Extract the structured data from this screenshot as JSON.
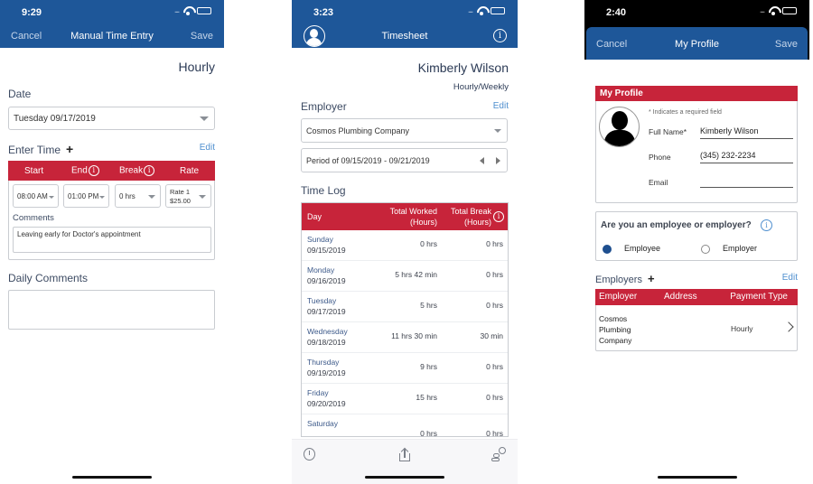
{
  "colors": {
    "nav_blue": "#1e5799",
    "header_red": "#c7243a",
    "link_blue": "#4f8fcf"
  },
  "screen1": {
    "status_time": "9:29",
    "nav": {
      "left": "Cancel",
      "title": "Manual Time Entry",
      "right": "Save"
    },
    "pay_type": "Hourly",
    "date_label": "Date",
    "date_value": "Tuesday 09/17/2019",
    "enter_time_label": "Enter Time",
    "add_icon": "plus-icon",
    "edit_label": "Edit",
    "columns": [
      "Start",
      "End",
      "Break",
      "Rate"
    ],
    "start_value": "08:00 AM",
    "end_value": "01:00 PM",
    "break_value": "0 hrs",
    "rate_line1": "Rate 1",
    "rate_line2": "$25.00",
    "comments_label": "Comments",
    "comments_value": "Leaving early for Doctor's appointment",
    "daily_comments_label": "Daily Comments",
    "daily_comments_value": ""
  },
  "screen2": {
    "status_time": "3:23",
    "nav": {
      "title": "Timesheet",
      "left_icon": "avatar-icon",
      "right_icon": "info-icon"
    },
    "user_name": "Kimberly Wilson",
    "pay_schedule": "Hourly/Weekly",
    "employer_label": "Employer",
    "edit_label": "Edit",
    "employer_value": "Cosmos Plumbing Company",
    "period_value": "Period of 09/15/2019 - 09/21/2019",
    "time_log_label": "Time Log",
    "table_headers": {
      "day": "Day",
      "worked_1": "Total Worked",
      "worked_2": "(Hours)",
      "break_1": "Total Break",
      "break_2": "(Hours)"
    },
    "rows": [
      {
        "day": "Sunday",
        "date": "09/15/2019",
        "worked": "0 hrs",
        "break": "0 hrs"
      },
      {
        "day": "Monday",
        "date": "09/16/2019",
        "worked": "5 hrs 42 min",
        "break": "0 hrs"
      },
      {
        "day": "Tuesday",
        "date": "09/17/2019",
        "worked": "5 hrs",
        "break": "0 hrs"
      },
      {
        "day": "Wednesday",
        "date": "09/18/2019",
        "worked": "11 hrs 30 min",
        "break": "30 min"
      },
      {
        "day": "Thursday",
        "date": "09/19/2019",
        "worked": "9 hrs",
        "break": "0 hrs"
      },
      {
        "day": "Friday",
        "date": "09/20/2019",
        "worked": "15 hrs",
        "break": "0 hrs"
      },
      {
        "day": "Saturday",
        "date": "",
        "worked": "0 hrs",
        "break": "0 hrs"
      }
    ],
    "tabbar_icons": [
      "stopwatch-icon",
      "share-icon",
      "map-pin-icon"
    ]
  },
  "screen3": {
    "status_time": "2:40",
    "nav": {
      "left": "Cancel",
      "title": "My Profile",
      "right": "Save"
    },
    "profile_header": "My Profile",
    "required_note": "* Indicates a required field",
    "full_name_label": "Full Name*",
    "full_name_value": "Kimberly Wilson",
    "phone_label": "Phone",
    "phone_value": "(345) 232-2234",
    "email_label": "Email",
    "email_value": "",
    "role_question": "Are you an employee or employer?",
    "role_options": [
      {
        "label": "Employee",
        "selected": true
      },
      {
        "label": "Employer",
        "selected": false
      }
    ],
    "employers_label": "Employers",
    "edit_label": "Edit",
    "employer_table_headers": [
      "Employer",
      "Address",
      "Payment Type"
    ],
    "employer_rows": [
      {
        "employer_l1": "Cosmos",
        "employer_l2": "Plumbing",
        "employer_l3": "Company",
        "address": "",
        "payment_type": "Hourly"
      }
    ]
  }
}
